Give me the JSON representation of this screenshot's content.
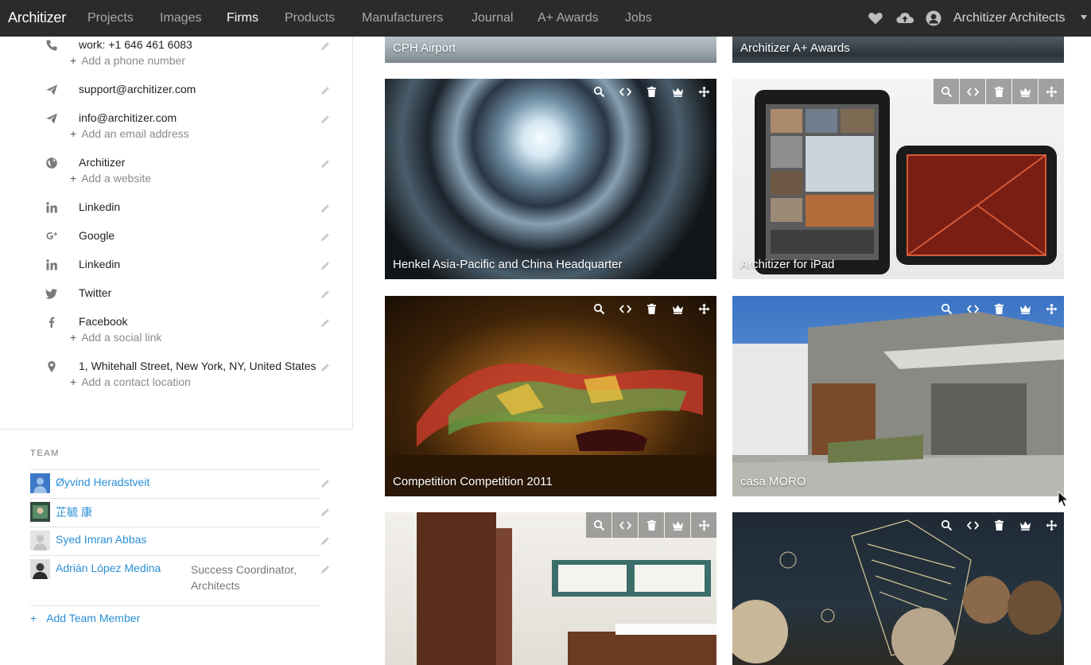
{
  "nav": {
    "logo": "Architizer",
    "items": [
      {
        "label": "Projects",
        "active": false
      },
      {
        "label": "Images",
        "active": false
      },
      {
        "label": "Firms",
        "active": true
      },
      {
        "label": "Products",
        "active": false
      },
      {
        "label": "Manufacturers",
        "active": false
      },
      {
        "label": "Journal",
        "active": false
      },
      {
        "label": "A+ Awards",
        "active": false
      },
      {
        "label": "Jobs",
        "active": false
      }
    ],
    "user_name": "Architizer Architects",
    "icons": [
      "heart-icon",
      "upload-cloud-icon",
      "user-icon",
      "caret-down-icon"
    ]
  },
  "contact": {
    "phone": "work: +1 646 461 6083",
    "add_phone": "Add a phone number",
    "email_support": "support@architizer.com",
    "email_info": "info@architizer.com",
    "add_email": "Add an email address",
    "website": "Architizer",
    "add_website": "Add a website",
    "linkedin_1": "Linkedin",
    "google": "Google",
    "linkedin_2": "Linkedin",
    "twitter": "Twitter",
    "facebook": "Facebook",
    "add_social": "Add a social link",
    "location": "1, Whitehall Street, New York, NY, United States",
    "add_location": "Add a contact location",
    "add_plus": "+"
  },
  "team": {
    "title": "TEAM",
    "members": [
      {
        "name": "Øyvind Heradstveit",
        "role": ""
      },
      {
        "name": "芷毓 康",
        "role": ""
      },
      {
        "name": "Syed Imran Abbas",
        "role": ""
      },
      {
        "name": "Adrián López Medina",
        "role": "Success Coordinator, Architects"
      }
    ],
    "add_label": "Add Team Member",
    "add_plus": "+"
  },
  "projects": [
    {
      "title": "CPH Airport"
    },
    {
      "title": "Architizer A+ Awards"
    },
    {
      "title": "Henkel Asia-Pacific and China Headquarter"
    },
    {
      "title": "Architizer for iPad"
    },
    {
      "title": "Competition Competition 2011"
    },
    {
      "title": "casa MORO"
    },
    {
      "title": ""
    },
    {
      "title": ""
    }
  ],
  "card_tools": [
    "search-icon",
    "embed-code-icon",
    "trash-icon",
    "crown-icon",
    "move-icon"
  ],
  "colors": {
    "nav_bg": "#2b2b2b",
    "link": "#2a8fd6"
  }
}
